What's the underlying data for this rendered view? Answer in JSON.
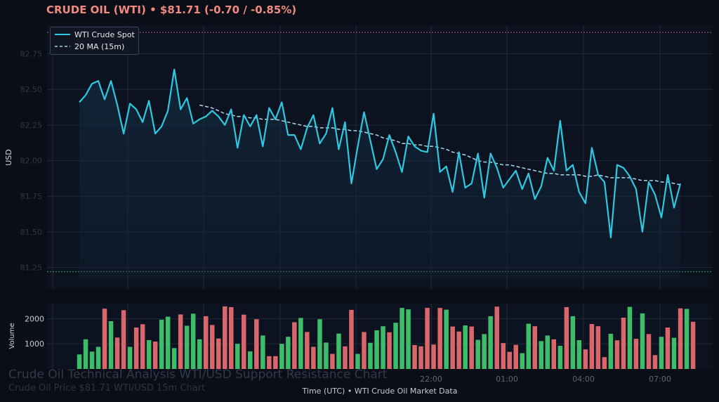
{
  "header": {
    "name": "CRUDE OIL (WTI)",
    "bullet": "•",
    "price": "$81.71",
    "change": "(-0.70 / -0.85%)"
  },
  "watermark": {
    "title": "Crude Oil Technical Analysis WTI/USD Support Resistance Chart",
    "subtitle": "Crude Oil Price $81.71 WTI/USD 15m Chart"
  },
  "x_caption": {
    "axis": "Time (UTC)",
    "bullet": "•",
    "source": "WTI Crude Oil Market Data"
  },
  "colors": {
    "background": "#0b0e17",
    "panel": "#0d1220",
    "price_line": "#2ec9e0",
    "ma_line": "#a8d8ec",
    "volume_up": "#3dbd6a",
    "volume_down": "#d9666b",
    "resistance": "#d9666b",
    "support": "#3dbd6a",
    "grid": "#1f2838"
  },
  "chart_data": [
    {
      "type": "line",
      "ylabel": "USD",
      "xlabel": "Time (UTC)",
      "ylim": [
        81.1,
        82.95
      ],
      "yticks": [
        81.25,
        81.5,
        81.75,
        82.0,
        82.25,
        82.5,
        82.75
      ],
      "ytick_labels": [
        "81.25",
        "81.50",
        "81.75",
        "82.00",
        "82.25",
        "82.50",
        "82.75"
      ],
      "xticks": [
        "22:00",
        "01:00",
        "04:00",
        "07:00"
      ],
      "legend_position": "top-left",
      "grid": true,
      "series": [
        {
          "name": "WTI Crude Spot",
          "style": "solid",
          "values": [
            82.41,
            82.46,
            82.54,
            82.56,
            82.43,
            82.56,
            82.39,
            82.19,
            82.4,
            82.36,
            82.27,
            82.42,
            82.19,
            82.24,
            82.35,
            82.64,
            82.36,
            82.44,
            82.26,
            82.29,
            82.31,
            82.35,
            82.31,
            82.25,
            82.36,
            82.09,
            82.32,
            82.24,
            82.32,
            82.1,
            82.37,
            82.29,
            82.41,
            82.18,
            82.18,
            82.08,
            82.23,
            82.32,
            82.12,
            82.19,
            82.37,
            82.08,
            82.27,
            81.84,
            82.1,
            82.34,
            82.14,
            81.94,
            82.01,
            82.18,
            82.06,
            81.92,
            82.17,
            82.1,
            82.07,
            82.06,
            82.33,
            81.92,
            81.96,
            81.78,
            82.06,
            81.81,
            81.84,
            82.05,
            81.74,
            82.05,
            81.95,
            81.81,
            81.87,
            81.93,
            81.8,
            81.91,
            81.73,
            81.82,
            82.02,
            81.93,
            82.28,
            81.93,
            81.97,
            81.78,
            81.7,
            82.09,
            81.9,
            81.85,
            81.46,
            81.97,
            81.95,
            81.89,
            81.8,
            81.5,
            81.85,
            81.76,
            81.6,
            81.9,
            81.67,
            81.84
          ]
        },
        {
          "name": "20 MA (15m)",
          "style": "dashed",
          "values": [
            null,
            null,
            null,
            null,
            null,
            null,
            null,
            null,
            null,
            null,
            null,
            null,
            null,
            null,
            null,
            null,
            null,
            null,
            null,
            82.39,
            82.38,
            82.37,
            82.35,
            82.33,
            82.32,
            82.31,
            82.31,
            82.3,
            82.3,
            82.29,
            82.29,
            82.29,
            82.28,
            82.27,
            82.26,
            82.25,
            82.24,
            82.24,
            82.23,
            82.23,
            82.23,
            82.22,
            82.22,
            82.21,
            82.21,
            82.2,
            82.19,
            82.18,
            82.16,
            82.15,
            82.14,
            82.12,
            82.12,
            82.11,
            82.11,
            82.1,
            82.1,
            82.09,
            82.08,
            82.06,
            82.05,
            82.04,
            82.02,
            82.0,
            81.99,
            81.99,
            81.98,
            81.97,
            81.97,
            81.96,
            81.95,
            81.94,
            81.93,
            81.92,
            81.91,
            81.91,
            81.9,
            81.9,
            81.9,
            81.9,
            81.89,
            81.89,
            81.9,
            81.89,
            81.88,
            81.88,
            81.88,
            81.88,
            81.87,
            81.86,
            81.86,
            81.86,
            81.85,
            81.85,
            81.84,
            81.83
          ]
        }
      ],
      "reference_lines": [
        {
          "kind": "resistance",
          "value": 82.9,
          "style": "dotted"
        },
        {
          "kind": "support",
          "value": 81.22,
          "style": "dotted"
        }
      ]
    },
    {
      "type": "bar",
      "ylabel": "Volume",
      "ylim": [
        0,
        2600
      ],
      "yticks": [
        1000,
        2000
      ],
      "ytick_labels": [
        "1000",
        "2000"
      ],
      "grid": true,
      "values": [
        580,
        1180,
        690,
        880,
        2400,
        1900,
        1250,
        2340,
        880,
        1650,
        1780,
        1150,
        1090,
        1960,
        2080,
        830,
        2170,
        1720,
        2200,
        1180,
        2100,
        1750,
        1210,
        2490,
        2460,
        1000,
        2160,
        700,
        1980,
        1330,
        510,
        510,
        1000,
        1280,
        1860,
        2030,
        1470,
        880,
        1980,
        1050,
        600,
        1410,
        900,
        2350,
        600,
        1470,
        1040,
        1540,
        1700,
        1460,
        1840,
        2430,
        2370,
        950,
        900,
        2430,
        970,
        2430,
        2360,
        1690,
        1490,
        1730,
        1690,
        1160,
        1390,
        2100,
        2480,
        1030,
        680,
        960,
        630,
        1800,
        1700,
        1110,
        1330,
        1180,
        920,
        2460,
        2100,
        1150,
        780,
        1790,
        1700,
        470,
        1400,
        1140,
        2040,
        2470,
        1200,
        2210,
        1390,
        550,
        1280,
        1650,
        1240,
        2410,
        2390,
        1880
      ],
      "directions": [
        "up",
        "up",
        "up",
        "up",
        "down",
        "up",
        "down",
        "down",
        "up",
        "down",
        "down",
        "up",
        "down",
        "up",
        "up",
        "up",
        "down",
        "up",
        "up",
        "up",
        "down",
        "down",
        "down",
        "down",
        "down",
        "up",
        "down",
        "up",
        "down",
        "up",
        "down",
        "down",
        "up",
        "up",
        "down",
        "up",
        "down",
        "down",
        "up",
        "up",
        "down",
        "up",
        "down",
        "down",
        "up",
        "down",
        "up",
        "up",
        "up",
        "down",
        "up",
        "up",
        "up",
        "down",
        "down",
        "down",
        "down",
        "down",
        "up",
        "down",
        "down",
        "up",
        "down",
        "up",
        "up",
        "up",
        "down",
        "down",
        "down",
        "down",
        "up",
        "up",
        "down",
        "up",
        "up",
        "down",
        "up",
        "down",
        "up",
        "up",
        "down",
        "down",
        "down",
        "down",
        "up",
        "down",
        "down",
        "up",
        "down",
        "up",
        "down",
        "down",
        "up",
        "down",
        "up",
        "down",
        "up"
      ]
    }
  ]
}
